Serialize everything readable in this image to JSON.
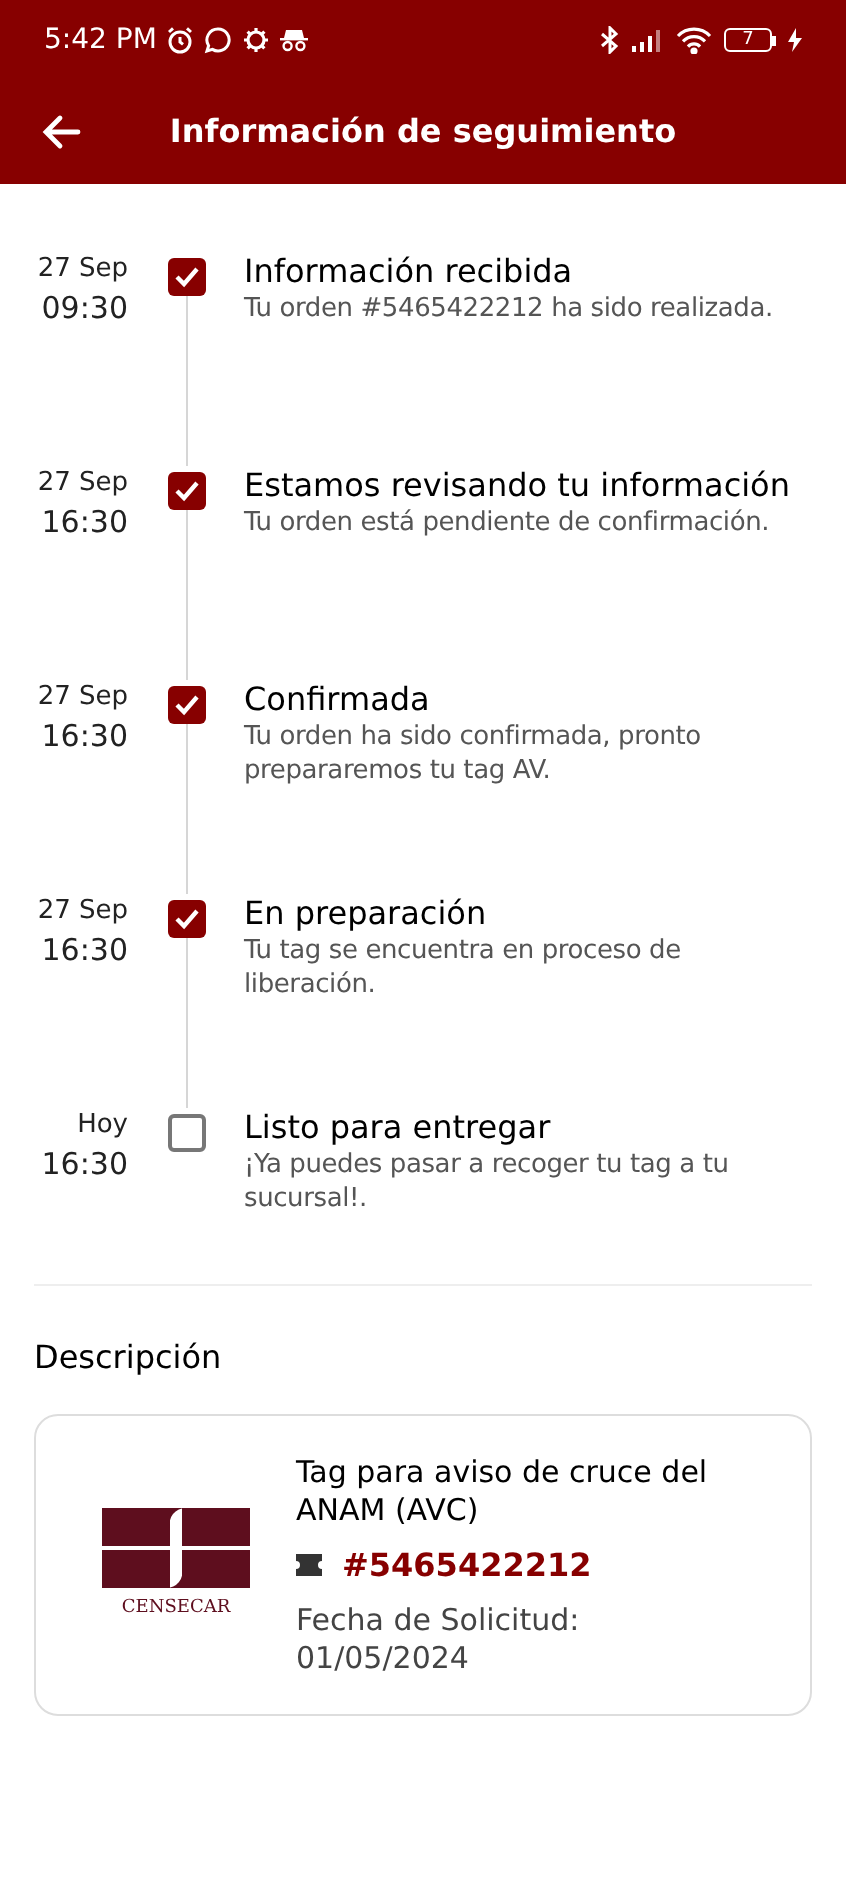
{
  "status_bar": {
    "time": "5:42 PM",
    "battery": "7"
  },
  "header": {
    "title": "Información de seguimiento"
  },
  "steps": [
    {
      "date": "27 Sep",
      "time": "09:30",
      "title": "Información recibida",
      "description": "Tu orden #5465422212 ha sido realizada.",
      "checked": true
    },
    {
      "date": "27 Sep",
      "time": "16:30",
      "title": "Estamos revisando tu información",
      "description": "Tu orden está pendiente de confirmación.",
      "checked": true
    },
    {
      "date": "27 Sep",
      "time": "16:30",
      "title": "Confirmada",
      "description": "Tu orden ha sido confirmada, pronto prepararemos tu tag AV.",
      "checked": true
    },
    {
      "date": "27 Sep",
      "time": "16:30",
      "title": "En preparación",
      "description": "Tu tag se encuentra en proceso de liberación.",
      "checked": true
    },
    {
      "date": "Hoy",
      "time": "16:30",
      "title": "Listo para entregar",
      "description": "¡Ya puedes pasar a recoger tu tag a tu sucursal!.",
      "checked": false
    }
  ],
  "description": {
    "heading": "Descripción",
    "logo_text": "CENSECAR",
    "product": "Tag para aviso de cruce del ANAM (AVC)",
    "order": "#5465422212",
    "date_label": "Fecha de Solicitud:",
    "date": "01/05/2024"
  }
}
